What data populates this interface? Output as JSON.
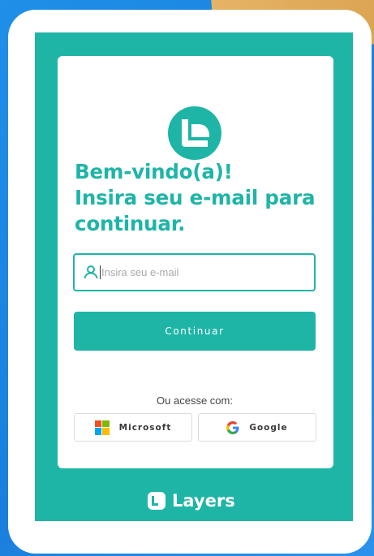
{
  "welcome": {
    "title_line1": "Bem-vindo(a)!",
    "title_line2": "Insira seu e-mail para",
    "title_line3": "continuar."
  },
  "email": {
    "placeholder": "Insira seu e-mail",
    "value": ""
  },
  "actions": {
    "continue_label": "Continuar",
    "alt_access_label": "Ou acesse com:",
    "microsoft_label": "Microsoft",
    "google_label": "Google"
  },
  "brand": {
    "name": "Layers"
  },
  "icons": [
    "layers-logo-icon",
    "user-icon",
    "microsoft-icon",
    "google-icon",
    "layers-brand-icon"
  ],
  "colors": {
    "accent": "#1fb5a6",
    "background": "#1f8fe8",
    "corner_accent": "#e6b466"
  }
}
